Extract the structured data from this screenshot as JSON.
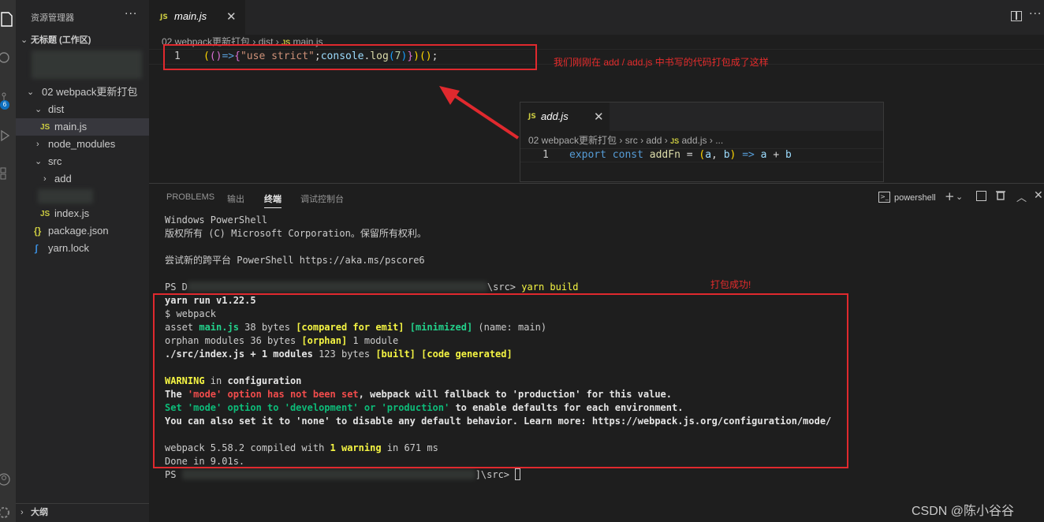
{
  "sidebar": {
    "title": "资源管理器",
    "more": "···",
    "workspace": "无标题 (工作区)",
    "tree": [
      {
        "label": "02 webpack更新打包"
      },
      {
        "label": "dist"
      },
      {
        "label": "main.js"
      },
      {
        "label": "node_modules"
      },
      {
        "label": "src"
      },
      {
        "label": "add"
      },
      {
        "label": "index.js"
      },
      {
        "label": "package.json"
      },
      {
        "label": "yarn.lock"
      }
    ],
    "outline": "大纲",
    "badge": "6"
  },
  "editor": {
    "tab": {
      "icon": "JS",
      "name": "main.js",
      "close": "✕"
    },
    "breadcrumb": {
      "folder": "02 webpack更新打包",
      "dist": "dist",
      "file": "main.js",
      "sep": "›"
    },
    "line_number": "1",
    "code": {
      "p1": "(",
      "p2": "()",
      "arrow": "=>",
      "brace_open": "{",
      "str": "\"use strict\"",
      "semi1": ";",
      "console": "console",
      "dot": ".",
      "log": "log",
      "paren_open": "(",
      "num": "7",
      "paren_close": ")",
      "brace_close": "}",
      "p3": ")",
      "call": "()",
      "semi2": ";"
    },
    "annotation": "我们刚刚在 add / add.js 中书写的代码打包成了这样",
    "more": "···"
  },
  "snippet": {
    "tab": {
      "icon": "JS",
      "name": "add.js",
      "close": "✕"
    },
    "breadcrumb": {
      "folder": "02 webpack更新打包",
      "src": "src",
      "add": "add",
      "file": "add.js",
      "ellipsis": "...",
      "sep": "›"
    },
    "line_number": "1",
    "code": {
      "export": "export",
      "const": "const",
      "fn": "addFn",
      "eq": "=",
      "args_open": "(",
      "a": "a",
      "comma": ",",
      "b": "b",
      "args_close": ")",
      "arrow": "=>",
      "a2": "a",
      "plus": "+",
      "b2": "b"
    }
  },
  "panel": {
    "tabs": [
      "PROBLEMS",
      "输出",
      "终端",
      "调试控制台"
    ],
    "active_tab": "终端",
    "shell": "powershell",
    "annotation": "打包成功!",
    "terminal": {
      "l1": "Windows PowerShell",
      "l2": "版权所有 (C) Microsoft Corporation。保留所有权利。",
      "l3": "尝试新的跨平台 PowerShell https://aka.ms/pscore6",
      "prompt_prefix": "PS D",
      "prompt_suffix": "\\src> ",
      "cmd": "yarn build",
      "yarn_run": "yarn run v1.22.5",
      "dollar_webpack": "$ webpack",
      "asset_a": "asset ",
      "asset_file": "main.js",
      "asset_b": " 38 bytes ",
      "asset_c": "[compared for emit]",
      "asset_d": " ",
      "asset_e": "[minimized]",
      "asset_f": " (name: main)",
      "orphan_a": "orphan modules 36 bytes ",
      "orphan_b": "[orphan]",
      "orphan_c": " 1 module",
      "src_a": "./src/index.js + 1 modules",
      "src_b": " 123 bytes ",
      "src_c": "[built]",
      "src_d": " ",
      "src_e": "[code generated]",
      "warn_a": "WARNING",
      "warn_b": " in ",
      "warn_c": "configuration",
      "mode_a": "The ",
      "mode_b": "'mode' option has not been set",
      "mode_c": ", webpack will fallback to 'production' for this value.",
      "set_a": "Set 'mode' option to 'development' or 'production'",
      "set_b": " to enable defaults for each environment.",
      "also": "You can also set it to 'none' to disable any default behavior. Learn more: https://webpack.js.org/configuration/mode/",
      "compiled_a": "webpack 5.58.2 compiled with ",
      "compiled_b": "1 warning",
      "compiled_c": " in 671 ms",
      "done": "Done in 9.01s.",
      "prompt2_prefix": "PS ",
      "prompt2_suffix": "]\\src> "
    }
  },
  "watermark": "CSDN @陈小谷谷"
}
